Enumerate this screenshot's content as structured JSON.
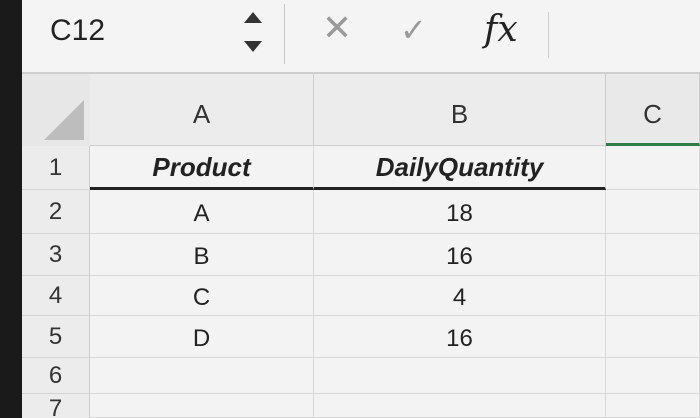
{
  "formula_bar": {
    "name_box": "C12",
    "cancel_icon": "✕",
    "enter_icon": "✓",
    "fx_label": "fx",
    "formula_value": ""
  },
  "columns": [
    "A",
    "B",
    "C"
  ],
  "rows": [
    "1",
    "2",
    "3",
    "4",
    "5",
    "6",
    "7"
  ],
  "table": {
    "headers": [
      "Product",
      "DailyQuantity"
    ],
    "data": [
      [
        "A",
        "18"
      ],
      [
        "B",
        "16"
      ],
      [
        "C",
        "4"
      ],
      [
        "D",
        "16"
      ]
    ]
  },
  "colors": {
    "active_column_accent": "#2e7d45"
  }
}
